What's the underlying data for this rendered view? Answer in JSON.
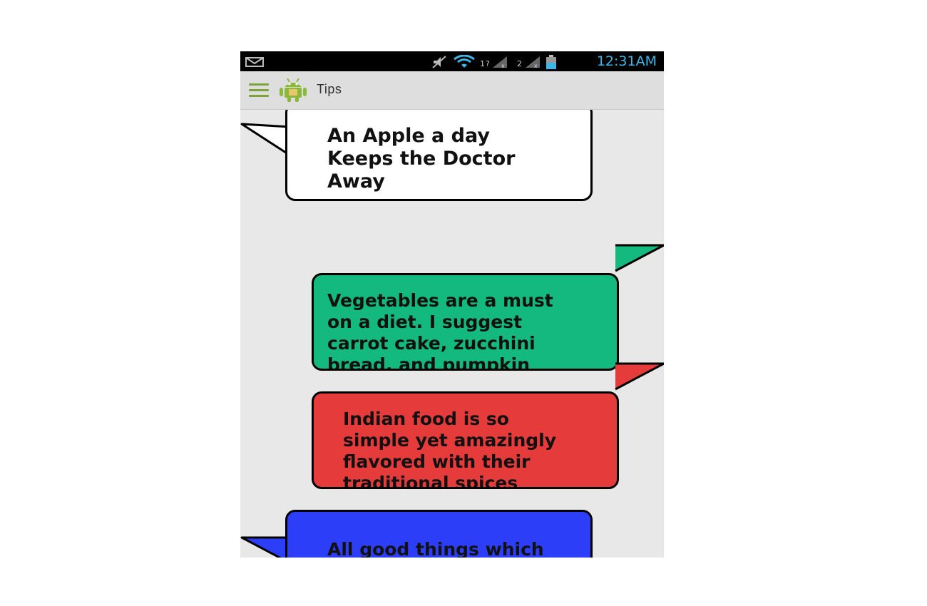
{
  "status_bar": {
    "time": "12:31AM",
    "icons": [
      "mail-icon",
      "mute-icon",
      "wifi-icon",
      "signal-icon",
      "signal-icon",
      "battery-icon"
    ],
    "time_color": "#3fb6e8"
  },
  "action_bar": {
    "title": "Tips",
    "icons": [
      "hamburger-menu-icon",
      "android-app-icon"
    ]
  },
  "tips": [
    {
      "text": "An Apple  a day\nKeeps  the Doctor\nAway",
      "color": "#ffffff",
      "tail": "left"
    },
    {
      "text": "Vegetables are a must\non a diet. I suggest\ncarrot cake, zucchini\nbread, and pumpkin",
      "color": "#14b97f",
      "tail": "right"
    },
    {
      "text": "Indian food is so\nsimple yet amazingly\nflavored with their\ntraditional spices",
      "color": "#e63b3b",
      "tail": "right"
    },
    {
      "text": "All good things which\nexist are the fruits of\noriginality.",
      "color": "#2c3ef7",
      "tail": "left"
    }
  ]
}
